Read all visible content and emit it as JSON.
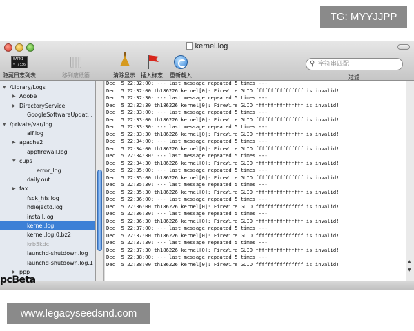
{
  "overlays": {
    "top_label": "TG: MYYJJPP",
    "bottom_label": "www.legacyseedsnd.com",
    "watermark": "pcBeta"
  },
  "window": {
    "title": "kernel.log"
  },
  "toolbar": {
    "hide_log_list": "隐藏日志列表",
    "move_to_trash": "移到废纸篓",
    "clear_display": "清除显示",
    "insert_marker": "插入标志",
    "reload": "重新载入",
    "console_icon_text": "UARNI\nV 7:36"
  },
  "search": {
    "placeholder": "字符串匹配",
    "value": "",
    "filter_label": "过滤"
  },
  "sidebar": {
    "items": [
      {
        "label": "/Library/Logs",
        "level": 0,
        "expanded": true,
        "selected": false,
        "dim": false
      },
      {
        "label": "Adobe",
        "level": 1,
        "expanded": false,
        "selected": false,
        "dim": false
      },
      {
        "label": "DirectoryService",
        "level": 1,
        "expanded": false,
        "selected": false,
        "dim": false
      },
      {
        "label": "GoogleSoftwareUpdat...",
        "level": 1,
        "leaf": true,
        "selected": false,
        "dim": false
      },
      {
        "label": "/private/var/log",
        "level": 0,
        "expanded": true,
        "selected": false,
        "dim": false
      },
      {
        "label": "alf.log",
        "level": 1,
        "leaf": true,
        "selected": false,
        "dim": false
      },
      {
        "label": "apache2",
        "level": 1,
        "expanded": false,
        "selected": false,
        "dim": false
      },
      {
        "label": "appfirewall.log",
        "level": 1,
        "leaf": true,
        "selected": false,
        "dim": false
      },
      {
        "label": "cups",
        "level": 1,
        "expanded": true,
        "selected": false,
        "dim": false
      },
      {
        "label": "error_log",
        "level": 2,
        "leaf": true,
        "selected": false,
        "dim": false
      },
      {
        "label": "daily.out",
        "level": 1,
        "leaf": true,
        "selected": false,
        "dim": false
      },
      {
        "label": "fax",
        "level": 1,
        "expanded": false,
        "selected": false,
        "dim": false
      },
      {
        "label": "fsck_hfs.log",
        "level": 1,
        "leaf": true,
        "selected": false,
        "dim": false
      },
      {
        "label": "hdiejectd.log",
        "level": 1,
        "leaf": true,
        "selected": false,
        "dim": false
      },
      {
        "label": "install.log",
        "level": 1,
        "leaf": true,
        "selected": false,
        "dim": false
      },
      {
        "label": "kernel.log",
        "level": 1,
        "leaf": true,
        "selected": true,
        "dim": false
      },
      {
        "label": "kernel.log.0.bz2",
        "level": 1,
        "leaf": true,
        "selected": false,
        "dim": false
      },
      {
        "label": "krb5kdc",
        "level": 1,
        "leaf": true,
        "selected": false,
        "dim": true
      },
      {
        "label": "launchd-shutdown.log",
        "level": 1,
        "leaf": true,
        "selected": false,
        "dim": false
      },
      {
        "label": "launchd-shutdown.log.1",
        "level": 1,
        "leaf": true,
        "selected": false,
        "dim": false
      },
      {
        "label": "ppp",
        "level": 1,
        "expanded": false,
        "selected": false,
        "dim": false
      }
    ]
  },
  "log": {
    "lines": [
      "Dec  5 22:32:00: --- last message repeated 5 times ---",
      "Dec  5 22:32:00 th186226 kernel[0]: FireWire GUID ffffffffffffffff is invalid!",
      "Dec  5 22:32:30: --- last message repeated 5 times ---",
      "Dec  5 22:32:30 th186226 kernel[0]: FireWire GUID ffffffffffffffff is invalid!",
      "Dec  5 22:33:00: --- last message repeated 5 times ---",
      "Dec  5 22:33:00 th186226 kernel[0]: FireWire GUID ffffffffffffffff is invalid!",
      "Dec  5 22:33:30: --- last message repeated 5 times ---",
      "Dec  5 22:33:30 th186226 kernel[0]: FireWire GUID ffffffffffffffff is invalid!",
      "Dec  5 22:34:00: --- last message repeated 5 times ---",
      "Dec  5 22:34:00 th186226 kernel[0]: FireWire GUID ffffffffffffffff is invalid!",
      "Dec  5 22:34:30: --- last message repeated 5 times ---",
      "Dec  5 22:34:30 th186226 kernel[0]: FireWire GUID ffffffffffffffff is invalid!",
      "Dec  5 22:35:00: --- last message repeated 5 times ---",
      "Dec  5 22:35:00 th186226 kernel[0]: FireWire GUID ffffffffffffffff is invalid!",
      "Dec  5 22:35:30: --- last message repeated 5 times ---",
      "Dec  5 22:35:30 th186226 kernel[0]: FireWire GUID ffffffffffffffff is invalid!",
      "Dec  5 22:36:00: --- last message repeated 5 times ---",
      "Dec  5 22:36:00 th186226 kernel[0]: FireWire GUID ffffffffffffffff is invalid!",
      "Dec  5 22:36:30: --- last message repeated 5 times ---",
      "Dec  5 22:36:30 th186226 kernel[0]: FireWire GUID ffffffffffffffff is invalid!",
      "Dec  5 22:37:00: --- last message repeated 5 times ---",
      "Dec  5 22:37:00 th186226 kernel[0]: FireWire GUID ffffffffffffffff is invalid!",
      "Dec  5 22:37:30: --- last message repeated 5 times ---",
      "Dec  5 22:37:30 th186226 kernel[0]: FireWire GUID ffffffffffffffff is invalid!",
      "Dec  5 22:38:00: --- last message repeated 5 times ---",
      "Dec  5 22:38:00 th186226 kernel[0]: FireWire GUID ffffffffffffffff is invalid!"
    ]
  },
  "colors": {
    "selection": "#3d80d6",
    "sidebar_bg": "#e4e9f0",
    "close": "#d9362a",
    "minimize": "#d9a21c",
    "zoom": "#3f9c24"
  }
}
